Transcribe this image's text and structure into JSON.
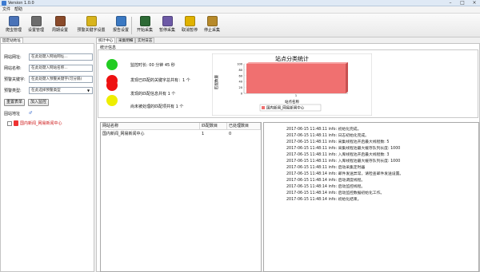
{
  "window": {
    "title": "Version 1.0.0",
    "minimize": "–",
    "maximize": "□",
    "close": "×"
  },
  "menu": {
    "items": [
      "文件",
      "帮助"
    ]
  },
  "toolbar": {
    "buttons": [
      {
        "label": "爬虫管理",
        "icon": "spider-manage-icon",
        "color": "#4a73b8"
      },
      {
        "label": "设置管理",
        "icon": "settings-manage-icon",
        "color": "#6c6c6c"
      },
      {
        "label": "周期设置",
        "icon": "cycle-settings-icon",
        "color": "#8a4a2a"
      },
      {
        "label": "预警关键字设置",
        "icon": "alert-keyword-icon",
        "color": "#d8b41c"
      },
      {
        "label": "报告设置",
        "icon": "report-settings-icon",
        "color": "#3a78c2"
      },
      {
        "label": "开始采集",
        "icon": "start-collect-icon",
        "color": "#2d6a35"
      },
      {
        "label": "暂停采集",
        "icon": "pause-collect-icon",
        "color": "#6d5aa6"
      },
      {
        "label": "取消暂停",
        "icon": "unlock-icon",
        "color": "#e0b200"
      },
      {
        "label": "停止采集",
        "icon": "stop-collect-icon",
        "color": "#b78a2a"
      }
    ]
  },
  "left": {
    "tab": "固定站地址",
    "fields": [
      {
        "label": "网站网址:",
        "placeholder": "在此处键入网站网址..."
      },
      {
        "label": "网站名称:",
        "placeholder": "在此处键入网站名称..."
      },
      {
        "label": "预警关键字:",
        "placeholder": "在此处键入预警关键字(可分隔)"
      },
      {
        "label": "预警类型:",
        "placeholder": "在此选择预警类型"
      }
    ],
    "reset_label": "重置表单",
    "add_label": "加入监控",
    "tree_title": "固站地址",
    "tree_item": "国内新闻_网易新闻中心"
  },
  "right": {
    "tabs": [
      "统计中心",
      "采集明细",
      "实时日志"
    ],
    "stats_title": "统计信息",
    "stats": [
      {
        "text": "监控时长: 00 分钟 45 秒",
        "color": "#22cc22"
      },
      {
        "text": "发现已匹配的关键字总共有：1 个",
        "color": "#ee1111"
      },
      {
        "text": "发现的匹配信息共有 1 个",
        "color": "#ee1111"
      },
      {
        "text": "尚未被处理的匹配项共有 1 个",
        "color": "#eeee00"
      }
    ]
  },
  "chart_data": {
    "type": "bar",
    "title": "站点分类统计",
    "xlabel": "站点名称",
    "ylabel": "匹配数量",
    "categories": [
      "1"
    ],
    "series": [
      {
        "name": "国内新闻_网易新闻中心",
        "values": [
          100
        ]
      }
    ],
    "ylim": [
      0,
      100
    ],
    "yticks": [
      "100",
      "80",
      "60",
      "40",
      "20",
      "0"
    ],
    "grid": true,
    "legend": "bottom",
    "color": "#f07070"
  },
  "table": {
    "headers": [
      "网站名称",
      "匹配数目",
      "已处理数目"
    ],
    "rows": [
      [
        "国内新闻_网易新闻中心",
        "1",
        "0"
      ]
    ]
  },
  "log": {
    "lines": [
      "2017-06-15 11:48:11 info: 初始化完成。",
      "2017-06-15 11:48:11 info: 日志初始化完成。",
      "2017-06-15 11:48:11 info: 采集线程池开启最大线程数: 5",
      "2017-06-15 11:48:11 info: 采集线程池最大缓存队列长度: 1000",
      "2017-06-15 11:48:11 info: 入库线程池开启最大线程数: 3",
      "2017-06-15 11:48:11 info: 入库线程池最大缓存队列长度: 1000",
      "2017-06-15 11:48:11 info: 启动采集定时器",
      "2017-06-15 11:48:14 info: 邮件发送异常，请检查邮件发送设置。",
      "2017-06-15 11:48:14 info: 启动调度线程。",
      "2017-06-15 11:48:14 info: 启动监控线程。",
      "2017-06-15 11:48:14 info: 启动监控数据初始化工作。",
      "2017-06-15 11:48:14 info: 初始化结束。"
    ]
  }
}
